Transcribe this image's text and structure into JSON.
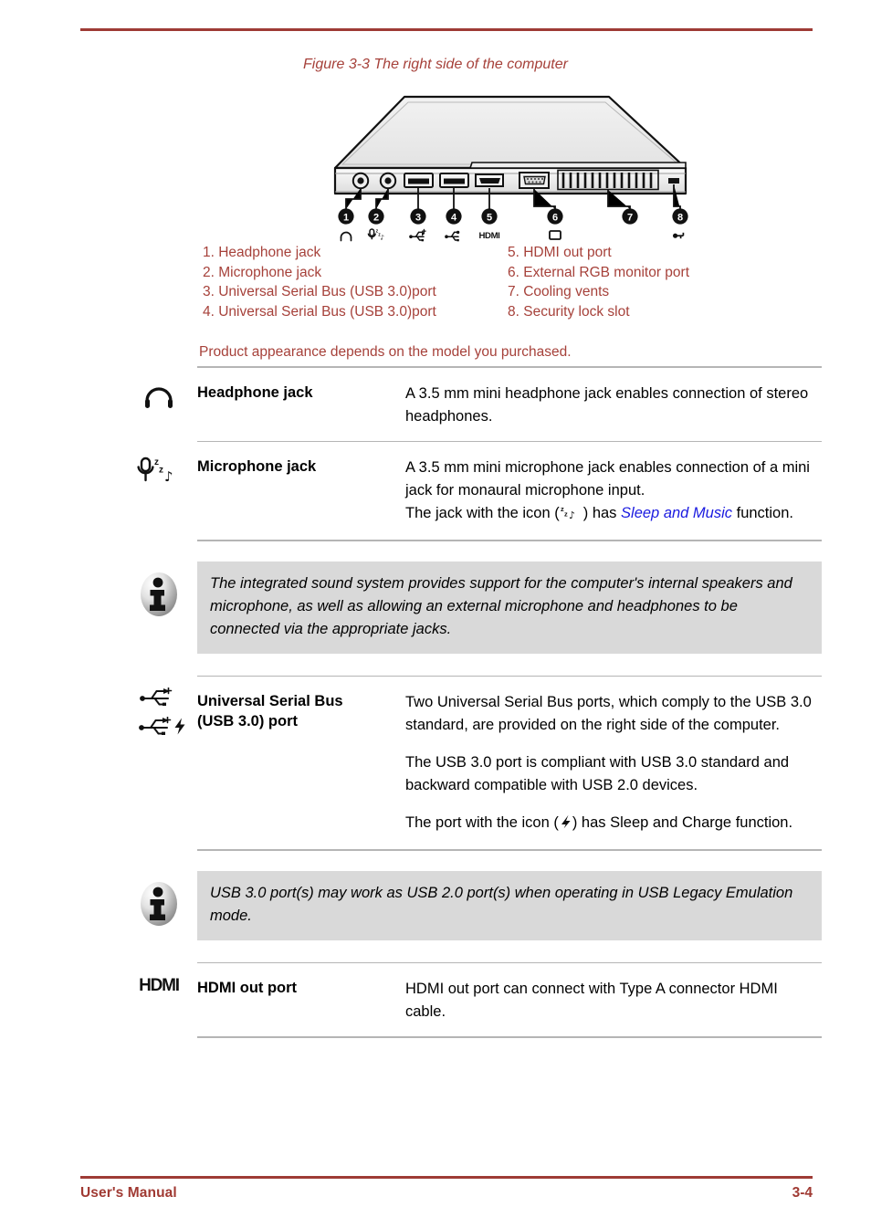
{
  "page": {
    "footer_left": "User's Manual",
    "footer_right": "3-4"
  },
  "figure": {
    "caption": "Figure 3-3 The right side of the computer",
    "callouts": [
      "1",
      "2",
      "3",
      "4",
      "5",
      "6",
      "7",
      "8"
    ],
    "product_note": "Product appearance depends on the model you purchased.",
    "legend_left": [
      "1. Headphone jack",
      "2. Microphone jack",
      "3. Universal Serial Bus (USB 3.0)port",
      "4. Universal Serial Bus (USB 3.0)port"
    ],
    "legend_right": [
      "5. HDMI out port",
      "6. External RGB monitor port",
      "7. Cooling vents",
      "8. Security lock slot"
    ]
  },
  "colors": {
    "accent_red": "#a6413a",
    "rule_red": "#9e3b35",
    "link_blue": "#1a1ae0",
    "note_bg": "#d9d9d9",
    "table_rule": "#b5b5b5"
  },
  "entries": {
    "headphone": {
      "term": "Headphone jack",
      "icon": "headphone-icon",
      "desc": "A 3.5 mm mini headphone jack enables connection of stereo headphones."
    },
    "microphone": {
      "term": "Microphone jack",
      "icon": "microphone-sleep-music-icon",
      "desc_1": "A 3.5 mm mini microphone jack enables connection of a mini jack for monaural microphone input.",
      "desc_2_before": "The jack with the icon (",
      "desc_2_after": ") has ",
      "desc_2_link": "Sleep and Music",
      "desc_2_end": " function."
    },
    "usb": {
      "term_line1": "Universal Serial Bus",
      "term_line2": "(USB 3.0) port",
      "icon_1": "usb-icon",
      "icon_2": "usb-sleep-charge-icon",
      "desc_1": "Two Universal Serial Bus ports, which comply to the USB 3.0 standard, are provided on the right side of the computer.",
      "desc_2": "The USB 3.0 port is compliant with USB 3.0 standard and backward compatible with USB 2.0 devices.",
      "desc_3_before": "The port with the icon (",
      "desc_3_after": ") has Sleep and Charge function."
    },
    "hdmi": {
      "term": "HDMI out port",
      "icon": "hdmi-logo-icon",
      "logo_text": "HDMI",
      "desc": "HDMI out port can connect with Type A connector HDMI cable."
    }
  },
  "notes": {
    "sound_system": "The integrated sound system provides support for the computer's internal speakers and microphone, as well as allowing an external microphone and headphones to be connected via the appropriate jacks.",
    "usb_legacy": "USB 3.0 port(s) may work as USB 2.0 port(s) when operating in USB Legacy Emulation mode."
  }
}
